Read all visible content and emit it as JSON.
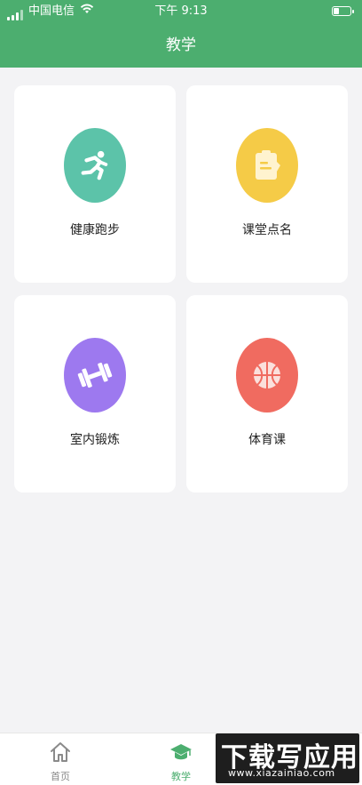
{
  "status_bar": {
    "carrier": "中国电信",
    "time": "下午 9:13"
  },
  "header": {
    "title": "教学"
  },
  "cards": [
    {
      "label": "健康跑步",
      "icon": "running-person-icon",
      "color": "#5cc3a9"
    },
    {
      "label": "课堂点名",
      "icon": "clipboard-icon",
      "color": "#f5cb47"
    },
    {
      "label": "室内锻炼",
      "icon": "dumbbell-icon",
      "color": "#9d79ef"
    },
    {
      "label": "体育课",
      "icon": "basketball-icon",
      "color": "#f06b60"
    }
  ],
  "tabbar": {
    "items": [
      {
        "label": "首页",
        "icon": "home-icon",
        "active": false
      },
      {
        "label": "教学",
        "icon": "graduation-cap-icon",
        "active": true
      }
    ]
  },
  "watermark": {
    "title": "下载写应用",
    "url": "www.xiazainiao.com"
  },
  "colors": {
    "primary": "#4cae6f",
    "background": "#f3f3f5"
  }
}
